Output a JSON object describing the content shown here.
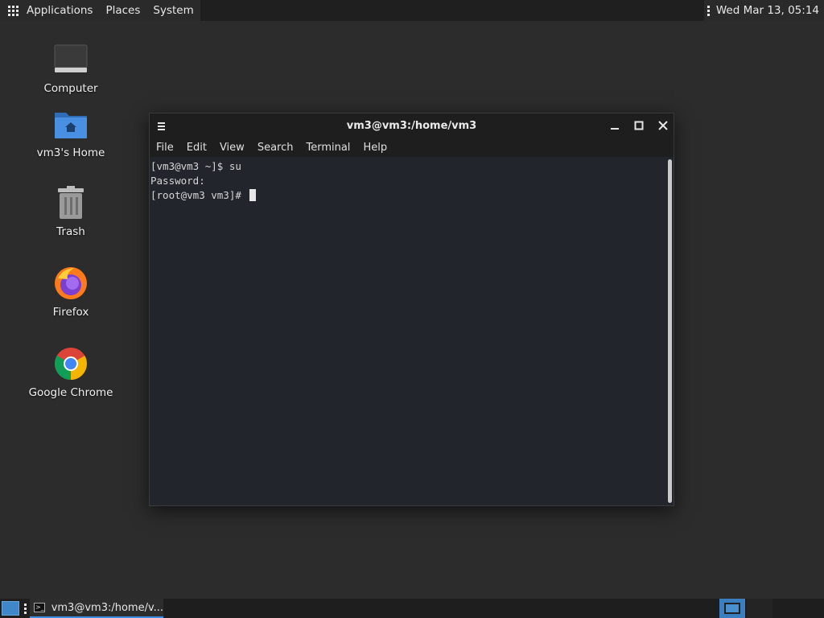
{
  "top_panel": {
    "applications": "Applications",
    "places": "Places",
    "system": "System",
    "clock": "Wed Mar 13, 05:14"
  },
  "desktop_icons": [
    {
      "label": "Computer",
      "icon": "computer-icon"
    },
    {
      "label": "vm3's Home",
      "icon": "home-folder-icon"
    },
    {
      "label": "Trash",
      "icon": "trash-icon"
    },
    {
      "label": "Firefox",
      "icon": "firefox-icon"
    },
    {
      "label": "Google Chrome",
      "icon": "chrome-icon"
    }
  ],
  "terminal": {
    "title": "vm3@vm3:/home/vm3",
    "menu": [
      "File",
      "Edit",
      "View",
      "Search",
      "Terminal",
      "Help"
    ],
    "lines": [
      "[vm3@vm3 ~]$ su",
      "Password:",
      "[root@vm3 vm3]# "
    ]
  },
  "taskbar": {
    "task_label": "vm3@vm3:/home/v...",
    "task_icon_text": ">_"
  },
  "colors": {
    "accent": "#3d8ee0",
    "terminal_bg": "#22252b",
    "panel_bg": "#1f1f1f"
  }
}
